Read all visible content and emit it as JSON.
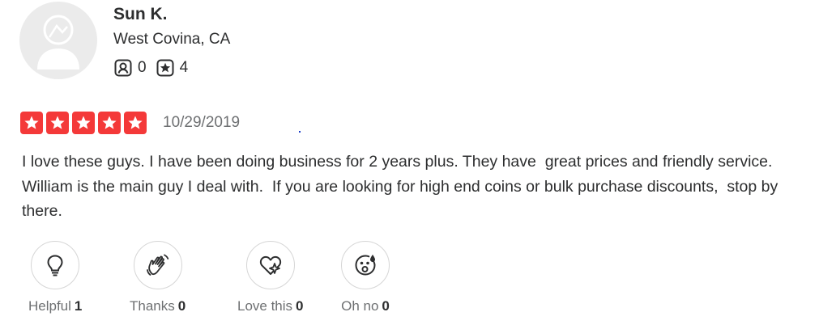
{
  "user": {
    "name": "Sun K.",
    "location": "West Covina, CA",
    "stats": [
      {
        "icon": "friends-icon",
        "value": "0"
      },
      {
        "icon": "review-star-icon",
        "value": "4"
      }
    ]
  },
  "review": {
    "rating": 5,
    "rating_max": 5,
    "star_color": "#f43939",
    "date": "10/29/2019",
    "text": "I love these guys. I have been doing business for 2 years plus. They have  great prices and friendly service. William is the main guy I deal with.  If you are looking for high end coins or bulk purchase discounts,  stop by there."
  },
  "reactions": [
    {
      "icon": "lightbulb-icon",
      "label": "Helpful",
      "count": "1"
    },
    {
      "icon": "waving-hand-icon",
      "label": "Thanks",
      "count": "0"
    },
    {
      "icon": "heart-icon",
      "label": "Love this",
      "count": "0"
    },
    {
      "icon": "surprised-face-icon",
      "label": "Oh no",
      "count": "0"
    }
  ]
}
